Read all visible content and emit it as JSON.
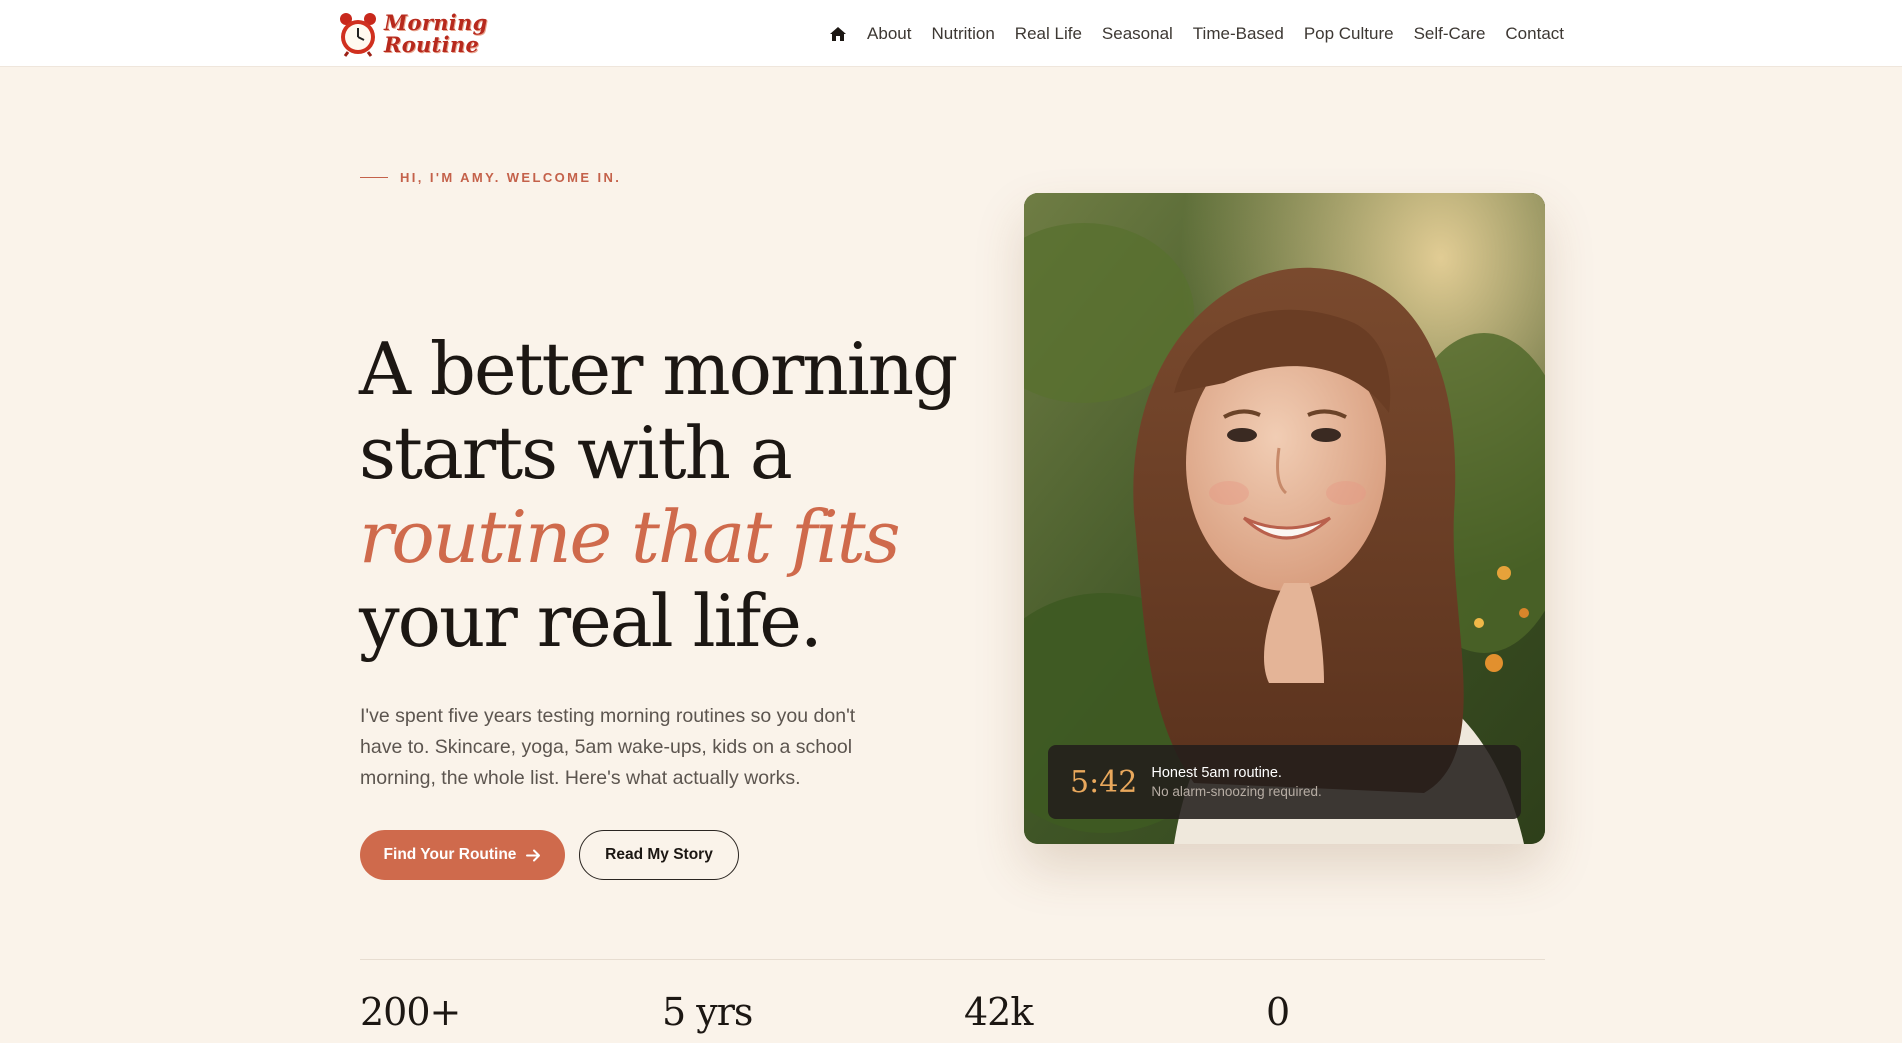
{
  "header": {
    "logo_line1": "Morning",
    "logo_line2": "Routine",
    "nav": [
      "About",
      "Nutrition",
      "Real Life",
      "Seasonal",
      "Time-Based",
      "Pop Culture",
      "Self-Care",
      "Contact"
    ]
  },
  "hero": {
    "eyebrow": "HI, I'M AMY. WELCOME IN.",
    "title_line1": "A better morning",
    "title_line2": "starts with a",
    "title_accent": "routine that fits",
    "title_line4": "your real life.",
    "body": "I've spent five years testing morning routines so you don't have to. Skincare, yoga, 5am wake-ups, kids on a school morning, the whole list. Here's what actually works.",
    "primary_button": "Find Your Routine",
    "secondary_button": "Read My Story"
  },
  "photo_badge": {
    "time": "5:42",
    "title": "Honest 5am routine.",
    "subtitle": "No alarm-snoozing required."
  },
  "stats": [
    "200+",
    "5 yrs",
    "42k",
    "0"
  ],
  "colors": {
    "background": "#faf3ea",
    "accent": "#cf6a4c",
    "logo_red": "#b7291d",
    "badge_time": "#e9a85c"
  },
  "icons": {
    "home": "home-icon",
    "arrow": "arrow-right-icon",
    "logo": "alarm-clock-icon"
  }
}
